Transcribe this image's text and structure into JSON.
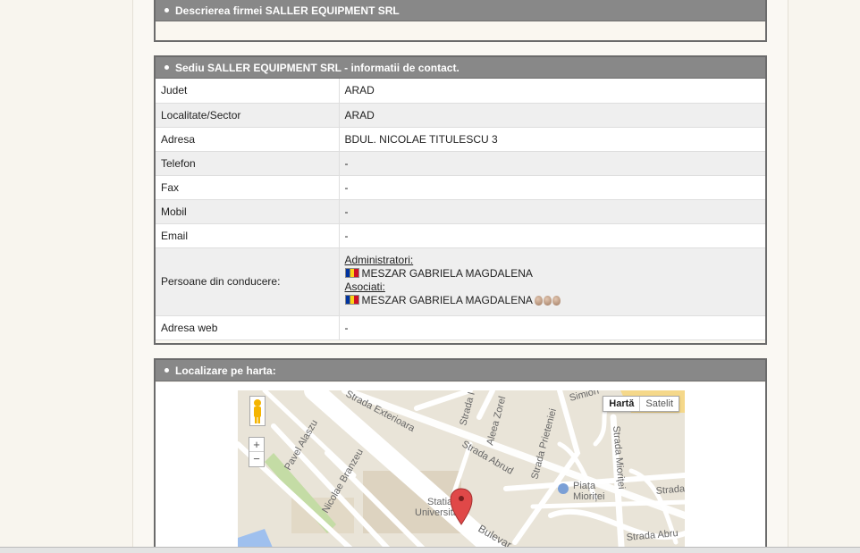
{
  "description_panel": {
    "title": "Descrierea firmei SALLER EQUIPMENT SRL"
  },
  "contact_panel": {
    "title": "Sediu SALLER EQUIPMENT SRL - informatii de contact.",
    "rows": [
      {
        "label": "Judet",
        "value": "ARAD"
      },
      {
        "label": "Localitate/Sector",
        "value": "ARAD"
      },
      {
        "label": "Adresa",
        "value": "BDUL. NICOLAE TITULESCU 3"
      },
      {
        "label": "Telefon",
        "value": "-"
      },
      {
        "label": "Fax",
        "value": "-"
      },
      {
        "label": "Mobil",
        "value": "-"
      },
      {
        "label": "Email",
        "value": "-"
      }
    ],
    "management": {
      "label": "Persoane din conducere:",
      "admins_heading": "Administratori:",
      "admin_name": "MESZAR GABRIELA MAGDALENA",
      "associates_heading": "Asociati:",
      "associate_name": "MESZAR GABRIELA MAGDALENA",
      "flag_colors": [
        "#0033a0",
        "#fcd116",
        "#ce1126"
      ]
    },
    "web": {
      "label": "Adresa web",
      "value": "-"
    }
  },
  "map_panel": {
    "title": "Localizare pe harta:",
    "map_type_active": "Hartă",
    "map_type_inactive": "Satelit",
    "zoom_in": "+",
    "zoom_out": "−",
    "labels": {
      "strada_exterioara": "Strada Exterioara",
      "strada_i": "Strada I",
      "aleea_zorele": "Aleea Zorel",
      "strada_prieteniei": "Strada Prieteniei",
      "simion": "Simion",
      "strada_miorita": "Strada Mioriței",
      "pavel_alaszu": "Pavel Alaszu",
      "nicolae_branzeu": "Nicolae Branzeu",
      "strada_abrud": "Strada Abrud",
      "statia": "Statia",
      "universita": "Universita",
      "bulevard": "Bulevar",
      "piata": "Piața",
      "miorita": "Mioriței",
      "strada_right": "Strada",
      "strada_abru": "Strada Abru"
    },
    "colors": {
      "road": "#ffffff",
      "land": "#e9e4d8",
      "park": "#c4dca5",
      "water": "#9fc0ee",
      "pin": "#e04848",
      "building": "#ddd3c0"
    }
  }
}
